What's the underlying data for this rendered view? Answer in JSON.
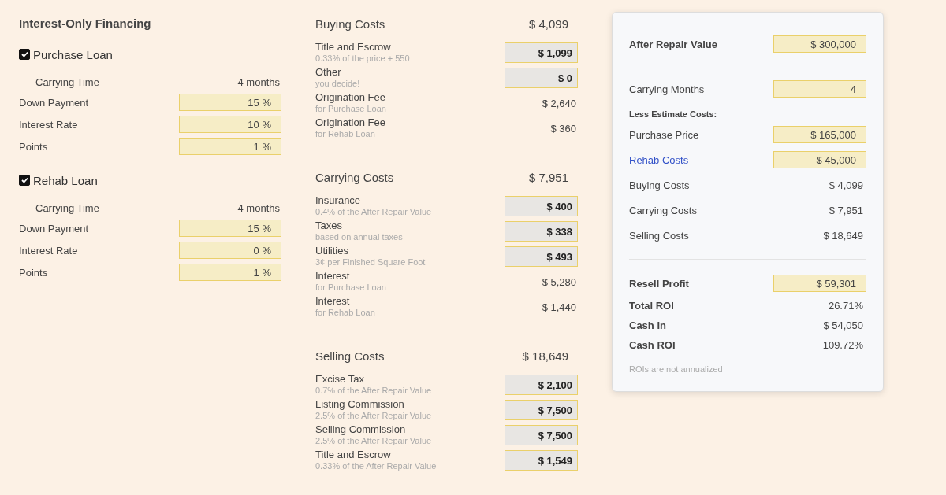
{
  "financing": {
    "title": "Interest-Only Financing",
    "loans": [
      {
        "label": "Purchase Loan",
        "checked": true,
        "carrying_label": "Carrying Time",
        "carrying_value": "4 months",
        "fields": [
          {
            "label": "Down Payment",
            "value": "15 %"
          },
          {
            "label": "Interest Rate",
            "value": "10 %"
          },
          {
            "label": "Points",
            "value": "1 %"
          }
        ]
      },
      {
        "label": "Rehab Loan",
        "checked": true,
        "carrying_label": "Carrying Time",
        "carrying_value": "4 months",
        "fields": [
          {
            "label": "Down Payment",
            "value": "15 %"
          },
          {
            "label": "Interest Rate",
            "value": "0 %"
          },
          {
            "label": "Points",
            "value": "1 %"
          }
        ]
      }
    ]
  },
  "cost_sections": [
    {
      "title": "Buying Costs",
      "total": "$ 4,099",
      "items": [
        {
          "kind": "input",
          "label": "Title and Escrow",
          "note": "0.33% of the price + 550",
          "value": "$ 1,099"
        },
        {
          "kind": "input",
          "label": "Other",
          "note": "you decide!",
          "value": "$ 0"
        },
        {
          "kind": "text",
          "label": "Origination Fee",
          "note": "for Purchase Loan",
          "value": "$ 2,640"
        },
        {
          "kind": "text",
          "label": "Origination Fee",
          "note": "for Rehab Loan",
          "value": "$ 360"
        }
      ]
    },
    {
      "title": "Carrying Costs",
      "total": "$ 7,951",
      "items": [
        {
          "kind": "input",
          "label": "Insurance",
          "note": "0.4% of the After Repair Value",
          "value": "$ 400"
        },
        {
          "kind": "input",
          "label": "Taxes",
          "note": "based on annual taxes",
          "value": "$ 338"
        },
        {
          "kind": "input",
          "label": "Utilities",
          "note": "3¢ per Finished Square Foot",
          "value": "$ 493"
        },
        {
          "kind": "text",
          "label": "Interest",
          "note": "for Purchase Loan",
          "value": "$ 5,280"
        },
        {
          "kind": "text",
          "label": "Interest",
          "note": "for Rehab Loan",
          "value": "$ 1,440"
        }
      ]
    },
    {
      "title": "Selling Costs",
      "total": "$ 18,649",
      "items": [
        {
          "kind": "input",
          "label": "Excise Tax",
          "note": "0.7% of the After Repair Value",
          "value": "$ 2,100"
        },
        {
          "kind": "input",
          "label": "Listing Commission",
          "note": "2.5% of the After Repair Value",
          "value": "$ 7,500"
        },
        {
          "kind": "input",
          "label": "Selling Commission",
          "note": "2.5% of the After Repair Value",
          "value": "$ 7,500"
        },
        {
          "kind": "input",
          "label": "Title and Escrow",
          "note": "0.33% of the After Repair Value",
          "value": "$ 1,549"
        }
      ]
    }
  ],
  "summary": {
    "after_repair": {
      "label": "After Repair Value",
      "value": "$ 300,000"
    },
    "carrying": {
      "label": "Carrying Months",
      "value": "4"
    },
    "less_heading": "Less Estimate Costs:",
    "costs": [
      {
        "kind": "input",
        "label": "Purchase Price",
        "value": "$ 165,000",
        "link": false
      },
      {
        "kind": "input",
        "label": "Rehab Costs",
        "value": "$ 45,000",
        "link": true
      },
      {
        "kind": "text",
        "label": "Buying Costs",
        "value": "$ 4,099",
        "link": false
      },
      {
        "kind": "text",
        "label": "Carrying Costs",
        "value": "$ 7,951",
        "link": false
      },
      {
        "kind": "text",
        "label": "Selling Costs",
        "value": "$ 18,649",
        "link": false
      }
    ],
    "profit": {
      "label": "Resell Profit",
      "value": "$ 59,301"
    },
    "stats": [
      {
        "label": "Total ROI",
        "value": "26.71%"
      },
      {
        "label": "Cash In",
        "value": "$ 54,050"
      },
      {
        "label": "Cash ROI",
        "value": "109.72%"
      }
    ],
    "note": "ROIs are not annualized"
  }
}
